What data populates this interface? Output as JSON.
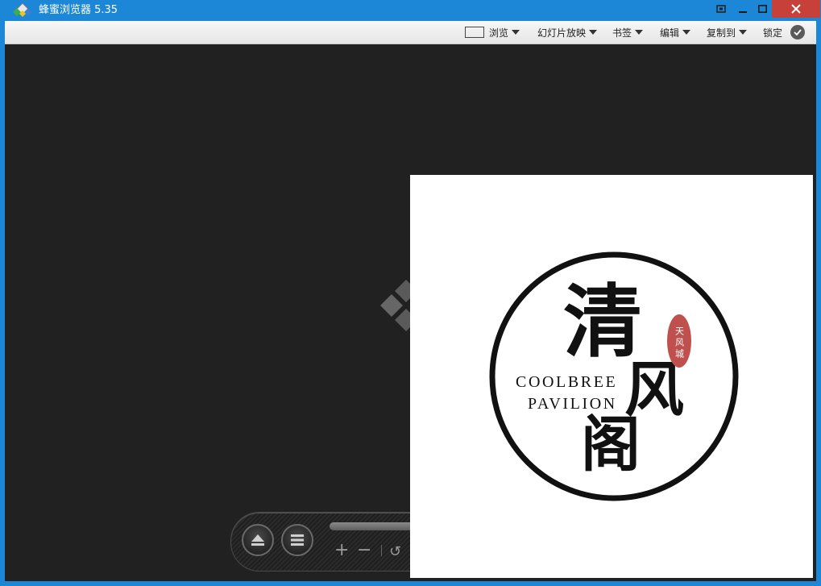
{
  "app": {
    "title": "蜂蜜浏览器 5.35"
  },
  "window_controls": {
    "fullscreen_icon": "fullscreen-icon",
    "minimize_icon": "minimize-icon",
    "maximize_icon": "maximize-icon",
    "close_icon": "close-icon"
  },
  "toolbar": {
    "browse_label": "浏览",
    "slideshow_label": "幻灯片放映",
    "bookmark_label": "书签",
    "edit_label": "编辑",
    "copyto_label": "复制到",
    "lock_label": "锁定"
  },
  "image": {
    "title_char_1": "清",
    "title_char_2": "风",
    "title_char_3": "阁",
    "english_line_1": "COOLBREE",
    "english_line_2": "PAVILION",
    "seal_text": "天风城"
  },
  "colors": {
    "titlebar": "#1c87d6",
    "close_button": "#c7413a",
    "viewer_background": "#212121",
    "seal": "#c0504d"
  }
}
